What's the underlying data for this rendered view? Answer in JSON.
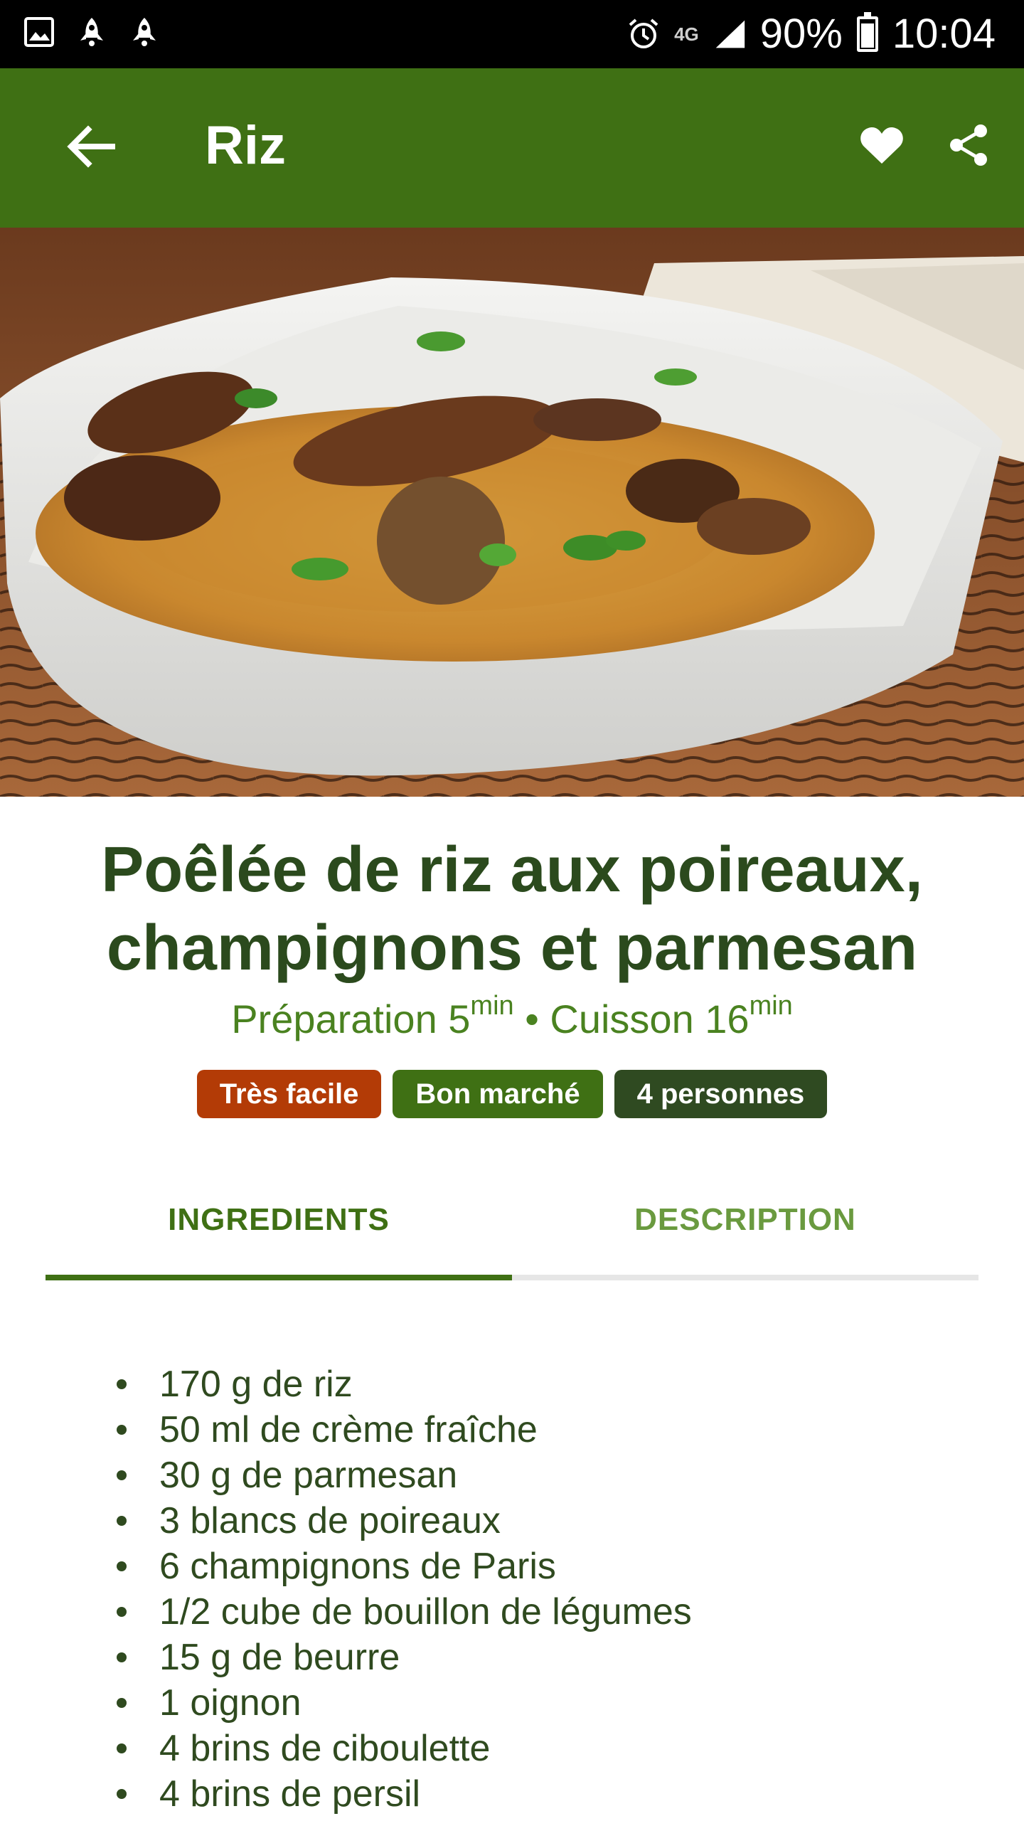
{
  "status_bar": {
    "left_icons": [
      "image-icon",
      "rocket-icon",
      "rocket-icon"
    ],
    "network": "4G",
    "battery": "90%",
    "battery_level": 0.9,
    "time": "10:04"
  },
  "app_bar": {
    "title": "Riz",
    "back_icon": "arrow-left-icon",
    "favorite_icon": "heart-icon",
    "share_icon": "share-icon",
    "color": "#3f7014"
  },
  "hero_image": {
    "description_icon": "food-photo"
  },
  "recipe": {
    "title_line1": "Poêlée de riz aux poireaux,",
    "title_line2": "champignons et parmesan",
    "prep_label": "Préparation 5",
    "prep_unit": "min",
    "separator": " • ",
    "cook_label": "Cuisson 16",
    "cook_unit": "min",
    "badges": {
      "difficulty": "Très facile",
      "cost": "Bon marché",
      "servings": "4 personnes"
    },
    "badge_colors": {
      "difficulty": "#b33b06",
      "cost": "#3f7014",
      "servings": "#2f4a21"
    }
  },
  "tabs": [
    {
      "label": "INGREDIENTS",
      "active": true
    },
    {
      "label": "DESCRIPTION",
      "active": false
    }
  ],
  "ingredients": [
    "170 g de riz",
    "50 ml de crème fraîche",
    "30 g de parmesan",
    "3 blancs de poireaux",
    "6 champignons de Paris",
    "1/2 cube de bouillon de légumes",
    "15 g de beurre",
    "1 oignon",
    "4 brins de ciboulette",
    "4 brins de persil"
  ]
}
